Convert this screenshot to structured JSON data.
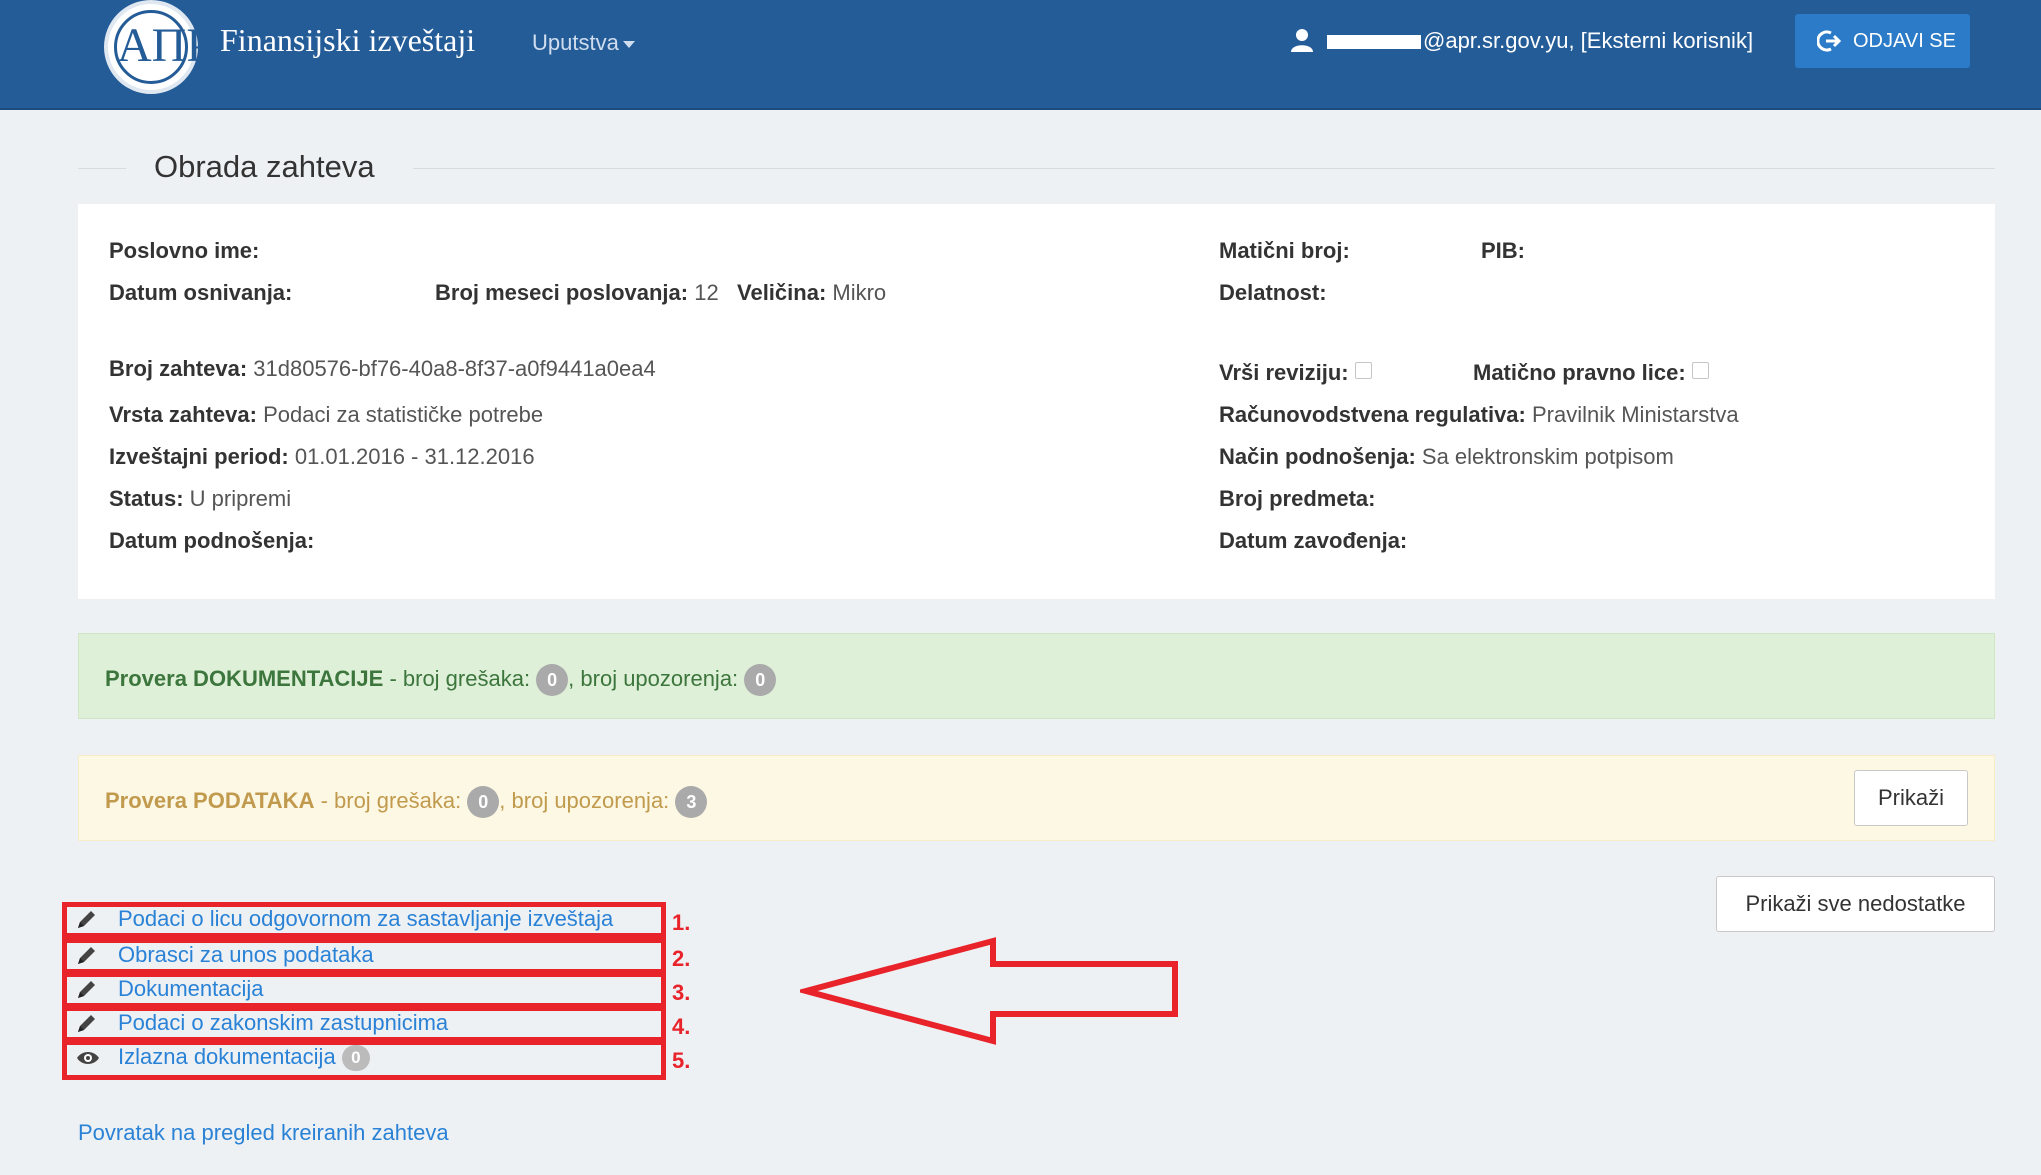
{
  "header": {
    "logo_text": "АПР",
    "brand": "Finansijski izveštaji",
    "menu_label": "Uputstva",
    "user_email": "@apr.sr.gov.yu",
    "user_role": ", [Eksterni korisnik]",
    "logout_label": "ODJAVI SE"
  },
  "page": {
    "title": "Obrada zahteva"
  },
  "info": {
    "poslovno_ime_label": "Poslovno ime:",
    "maticni_broj_label": "Matični broj:",
    "pib_label": "PIB:",
    "datum_osnivanja_label": "Datum osnivanja:",
    "broj_meseci_label": "Broj meseci poslovanja:",
    "broj_meseci_value": " 12",
    "velicina_label": "Veličina:",
    "velicina_value": " Mikro",
    "delatnost_label": "Delatnost:",
    "broj_zahteva_label": "Broj zahteva:",
    "broj_zahteva_value": " 31d80576-bf76-40a8-8f37-a0f9441a0ea4",
    "vrsi_reviziju_label": "Vrši reviziju:",
    "maticno_pravno_lice_label": "Matično pravno lice:",
    "vrsta_zahteva_label": "Vrsta zahteva:",
    "vrsta_zahteva_value": " Podaci za statističke potrebe",
    "racunovodstvena_label": "Računovodstvena regulativa:",
    "racunovodstvena_value": " Pravilnik Ministarstva",
    "izvestajni_period_label": "Izveštajni period:",
    "izvestajni_period_value": " 01.01.2016 - 31.12.2016",
    "nacin_label": "Način podnošenja:",
    "nacin_value": " Sa elektronskim potpisom",
    "status_label": "Status:",
    "status_value": " U pripremi",
    "broj_predmeta_label": "Broj predmeta:",
    "datum_podnosenja_label": "Datum podnošenja:",
    "datum_zavodjenja_label": "Datum zavođenja:"
  },
  "alerts": {
    "dok_title": "Provera DOKUMENTACIJE",
    "dok_errors_label": " - broj grešaka: ",
    "dok_errors": "0",
    "dok_warnings_label": ", broj upozorenja: ",
    "dok_warnings": "0",
    "pod_title": "Provera PODATAKA",
    "pod_errors_label": " - broj grešaka: ",
    "pod_errors": "0",
    "pod_warnings_label": ", broj upozorenja: ",
    "pod_warnings": "3",
    "prikazi_label": "Prikaži"
  },
  "actions": {
    "prikazi_sve_label": "Prikaži sve nedostatke"
  },
  "links": [
    {
      "label": "Podaci o licu odgovornom za sastavljanje izveštaja",
      "num": "1.",
      "icon": "pencil-icon"
    },
    {
      "label": "Obrasci za unos podataka",
      "num": "2.",
      "icon": "pencil-icon"
    },
    {
      "label": "Dokumentacija",
      "num": "3.",
      "icon": "pencil-icon"
    },
    {
      "label": "Podaci o zakonskim zastupnicima",
      "num": "4.",
      "icon": "pencil-icon"
    },
    {
      "label": "Izlazna dokumentacija",
      "num": "5.",
      "icon": "eye-icon",
      "badge": "0"
    }
  ],
  "footer": {
    "back_label": "Povratak na pregled kreiranih zahteva"
  },
  "colors": {
    "navbar": "#245c98",
    "link": "#2a82d6",
    "annotation": "#e8232a",
    "success_text": "#3c763d",
    "warning_text": "#c19a4e"
  }
}
